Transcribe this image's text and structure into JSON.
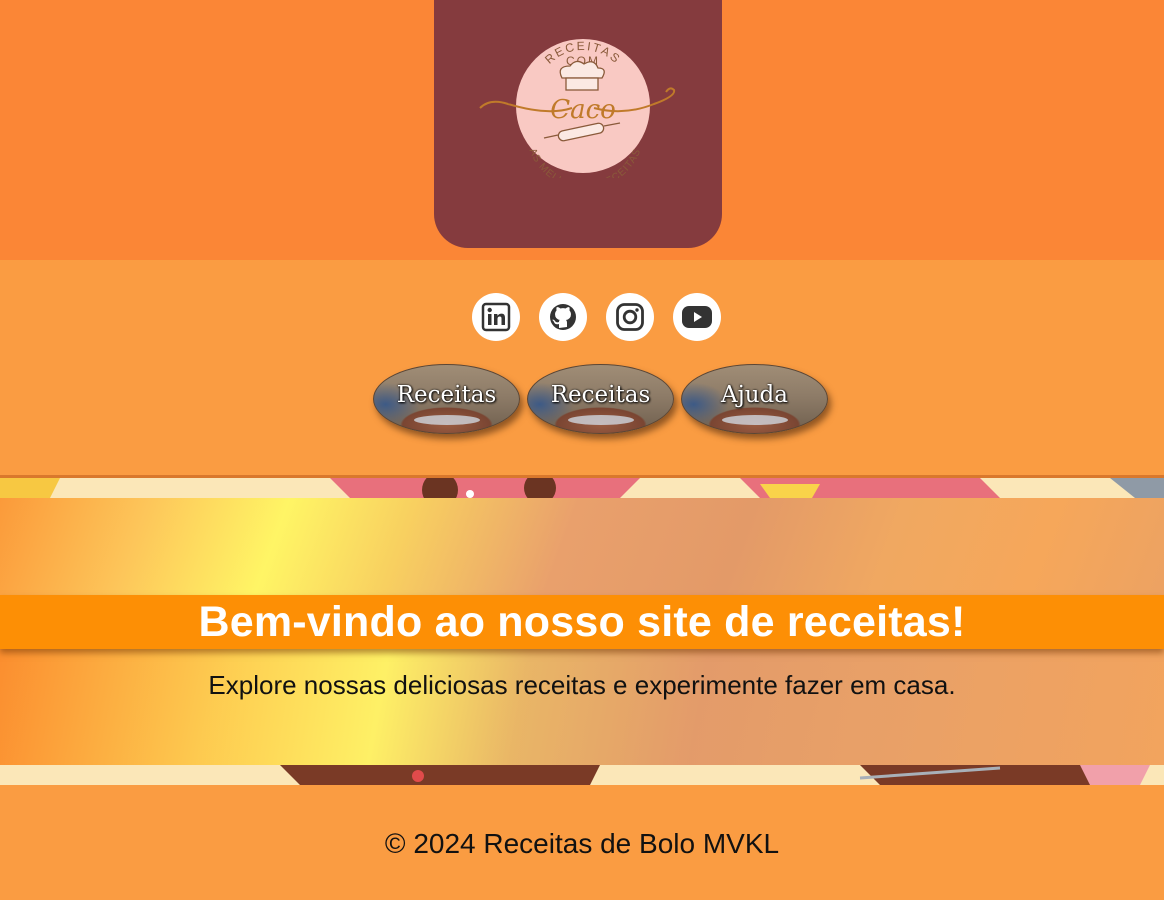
{
  "logo": {
    "line1": "RECEITAS",
    "line2": "COM",
    "name": "Caco",
    "tagline": "AS MELHORES RECEITAS",
    "card_color": "#853b3e",
    "badge_color": "#f9c9c3"
  },
  "socials": [
    {
      "name": "linkedin-icon"
    },
    {
      "name": "github-icon"
    },
    {
      "name": "instagram-icon"
    },
    {
      "name": "youtube-icon"
    }
  ],
  "nav": {
    "items": [
      {
        "label": "Receitas"
      },
      {
        "label": "Receitas"
      },
      {
        "label": "Ajuda"
      }
    ]
  },
  "hero": {
    "title": "Bem-vindo ao nosso site de receitas!",
    "subtitle": "Explore nossas deliciosas receitas e experimente fazer em casa."
  },
  "footer": {
    "text": "© 2024 Receitas de Bolo MVKL"
  },
  "colors": {
    "header_bg": "#fb8636",
    "page_bg": "#fa9c42",
    "title_bar": "#fd8f05"
  }
}
